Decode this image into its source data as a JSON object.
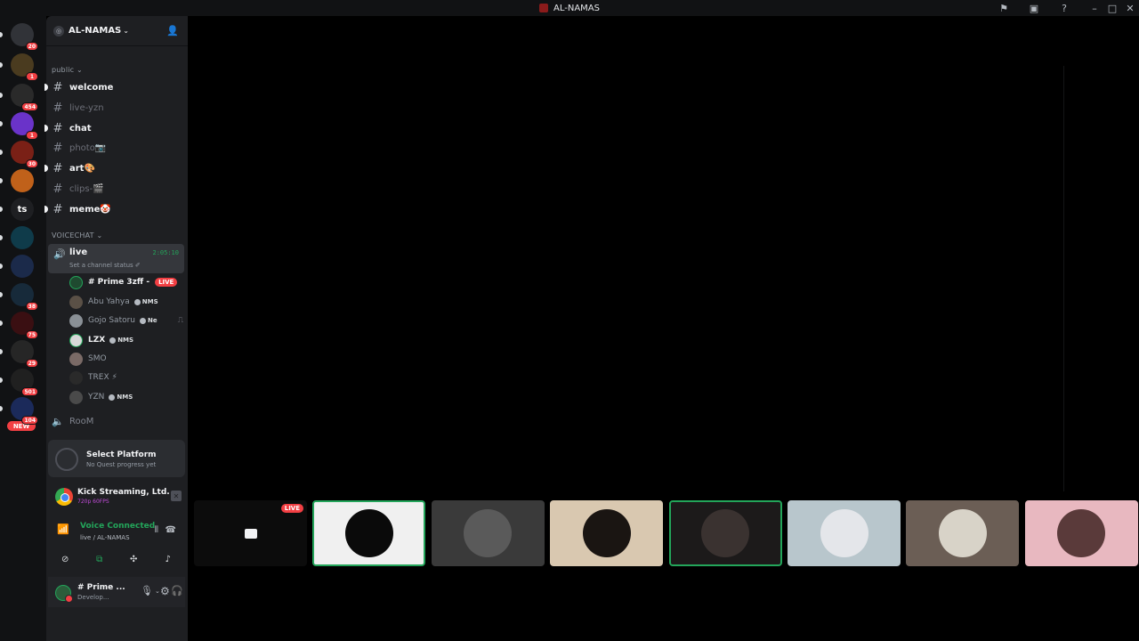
{
  "window": {
    "title": "AL-NAMAS",
    "controls": [
      "flag-icon",
      "inbox-icon",
      "help-icon",
      "minimize-icon",
      "maximize-icon",
      "close-icon"
    ]
  },
  "rail": {
    "servers": [
      {
        "name": "discord-home",
        "badge": "20",
        "color": "#313338"
      },
      {
        "name": "server-2",
        "badge": "1",
        "color": "#4a3b1f"
      },
      {
        "name": "server-3",
        "badge": "454",
        "color": "#2a2a2a"
      },
      {
        "name": "server-4",
        "badge": "1",
        "color": "#6a33c9"
      },
      {
        "name": "server-5",
        "badge": "30",
        "color": "#7a2016"
      },
      {
        "name": "server-6",
        "badge": "",
        "color": "#c0611a"
      },
      {
        "name": "server-ts",
        "label": "ts",
        "badge": "",
        "color": "#1e1f22"
      },
      {
        "name": "server-8",
        "badge": "",
        "color": "#0f3b4a"
      },
      {
        "name": "server-9",
        "badge": "",
        "color": "#1b2a4a"
      },
      {
        "name": "server-10",
        "badge": "38",
        "color": "#172a3a"
      },
      {
        "name": "server-11",
        "badge": "75",
        "color": "#3a0f12"
      },
      {
        "name": "server-12",
        "badge": "29",
        "color": "#262626"
      },
      {
        "name": "server-13",
        "badge": "501",
        "color": "#202020"
      },
      {
        "name": "server-14",
        "badge": "104",
        "color": "#1b2a5a"
      }
    ],
    "new_label": "NEW"
  },
  "sidebar": {
    "server_name": "AL-NAMAS",
    "categories": {
      "public": "public",
      "voice": "VOICECHAT"
    },
    "channels": [
      {
        "label": "welcome",
        "state": "unread"
      },
      {
        "label": "live-yzn",
        "state": "muted"
      },
      {
        "label": "chat",
        "state": "unread"
      },
      {
        "label": "photo📷",
        "state": "muted"
      },
      {
        "label": "art🎨",
        "state": "unread"
      },
      {
        "label": "clips-🎬",
        "state": "muted"
      },
      {
        "label": "meme🤡",
        "state": "unread"
      }
    ],
    "voice_channel": {
      "name": "live",
      "timer": "2:05:10",
      "status": "Set a channel status ✐"
    },
    "members": [
      {
        "name": "# Prime 3zff -",
        "live": "LIVE",
        "bright": true
      },
      {
        "name": "Abu Yahya",
        "tag": "NMS",
        "bright": false
      },
      {
        "name": "Gojo Satoru",
        "tag": "Ne",
        "bright": false
      },
      {
        "name": "LZX",
        "tag": "NMS",
        "bright": true
      },
      {
        "name": "SMO",
        "bright": false
      },
      {
        "name": "TREX ⚡",
        "bright": false
      },
      {
        "name": "YZN",
        "tag": "NMS",
        "bright": false
      }
    ],
    "room": "RooM"
  },
  "quest": {
    "title": "Select Platform",
    "subtitle": "No Quest progress yet"
  },
  "activity": {
    "title": "Kick Streaming, Ltd. | Set u...",
    "detail": "720p 60FPS"
  },
  "voice_connected": {
    "title": "Voice Connected",
    "channel": "live / AL-NAMAS"
  },
  "user": {
    "name": "# Prime ...",
    "status": "Develop..."
  },
  "stage": {
    "live_label": "LIVE",
    "tiles": [
      {
        "name": "tile-stream",
        "bg": "#0c0c0c",
        "live": true
      },
      {
        "name": "tile-troll",
        "bg": "#f0f0f0",
        "face": "#0a0a0a",
        "speaking": true
      },
      {
        "name": "tile-berserk",
        "bg": "#3a3a3a",
        "face": "#5a5a5a"
      },
      {
        "name": "tile-dark",
        "bg": "#d9c8b0",
        "face": "#1a1512"
      },
      {
        "name": "tile-room",
        "bg": "#1c1a1a",
        "face": "#3a3230",
        "speaking": true
      },
      {
        "name": "tile-gojo",
        "bg": "#b8c6cc",
        "face": "#e4e6ea"
      },
      {
        "name": "tile-cat",
        "bg": "#6b5e55",
        "face": "#d8d3c8"
      },
      {
        "name": "tile-pink",
        "bg": "#e8b8c0",
        "face": "#5a3a3a"
      }
    ]
  }
}
